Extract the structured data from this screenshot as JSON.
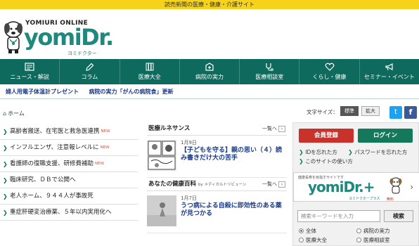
{
  "topbar": {
    "text": "読売新聞の医療・健康・介護サイト"
  },
  "logo": {
    "brand_top": "YOMIURI ONLINE",
    "brand": "yomiDr.",
    "brand_kana": "ヨミドクター"
  },
  "nav": [
    {
      "label": "ニュース・解説"
    },
    {
      "label": "コラム"
    },
    {
      "label": "医療大全"
    },
    {
      "label": "病院の実力"
    },
    {
      "label": "医療相談室"
    },
    {
      "label": "くらし・健康"
    },
    {
      "label": "セミナー・イベント"
    }
  ],
  "subnav": [
    {
      "label": "婦人用電子体温計プレゼント"
    },
    {
      "label": "病院の実力「がんの病院食」更新"
    }
  ],
  "breadcrumb": {
    "home": "ホーム"
  },
  "news": [
    {
      "title": "高齢者搬送、在宅医と救急医連携",
      "new": "NEW"
    },
    {
      "title": "インフルエンザ、注意報レベルに",
      "new": "NEW"
    },
    {
      "title": "看護師の復職支援、研修費補助",
      "new": "NEW"
    },
    {
      "title": "臨床研究、ＤＢで公開へ",
      "new": ""
    },
    {
      "title": "老人ホーム、９４４人が事故死",
      "new": ""
    },
    {
      "title": "重症肝硬変治療薬、５年以内実用化へ",
      "new": ""
    }
  ],
  "sections": [
    {
      "title": "医療ルネサンス",
      "by": "",
      "more": "一覧へ",
      "article": {
        "date": "1月9日",
        "title": "【子どもを守る】親の思い（４）読み書きだけ大の苦手"
      }
    },
    {
      "title": "あなたの健康百科",
      "by": "by メディカルトリビューン",
      "more": "一覧へ",
      "article": {
        "date": "1月7日",
        "title": "うつ病による自殺に即効性のある薬が見つかる"
      }
    }
  ],
  "font_size": {
    "label": "文字サイズ：",
    "standard": "標準",
    "large": "拡大"
  },
  "social": {
    "twitter": "t",
    "facebook": "f"
  },
  "member": {
    "register": "会員登録",
    "login": "ログイン",
    "forgot_id": "IDを忘れた方",
    "forgot_pw": "パスワードを忘れた方",
    "howto": "このサイトの使い方"
  },
  "plus_banner": {
    "small": "健康長寿を目指すサイトです",
    "brand": "yomiDr.",
    "plus": "+",
    "kana": "ヨミドクタープラス",
    "free": "無料"
  },
  "search": {
    "placeholder": "検索キーワードを入力",
    "button": "検索"
  },
  "scope": [
    {
      "label": "全体",
      "checked": true
    },
    {
      "label": "病院の実力",
      "checked": false
    },
    {
      "label": "医療大全",
      "checked": false
    },
    {
      "label": "医療相談室",
      "checked": false
    }
  ],
  "colors": {
    "brand_green": "#0f6a5e",
    "top_yellow": "#f6d21a",
    "register_red": "#c9312b",
    "login_green": "#13795a"
  }
}
